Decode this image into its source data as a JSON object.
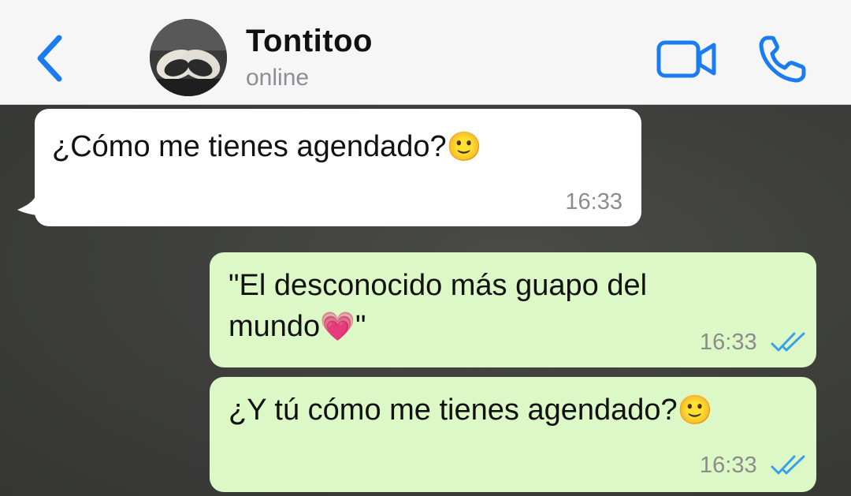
{
  "header": {
    "contact_name": "Tontitoo",
    "status": "online"
  },
  "icons": {
    "back": "chevron-left-icon",
    "video": "video-camera-icon",
    "call": "phone-icon",
    "read_receipt": "double-check-icon"
  },
  "colors": {
    "accent": "#1a7cf0",
    "incoming_bubble": "#ffffff",
    "outgoing_bubble": "#dcf8c6",
    "read_check": "#3aa0e8"
  },
  "messages": [
    {
      "direction": "incoming",
      "text": "¿Cómo me tienes agendado?",
      "emoji": "🙂",
      "time": "16:33"
    },
    {
      "direction": "outgoing",
      "text_line1": "\"El desconocido más guapo del",
      "text_line2a": "mundo",
      "emoji": "💗",
      "text_line2b": "\"",
      "time": "16:33",
      "status": "read"
    },
    {
      "direction": "outgoing",
      "text": "¿Y tú cómo me tienes agendado?",
      "emoji": "🙂",
      "time": "16:33",
      "status": "read"
    }
  ]
}
